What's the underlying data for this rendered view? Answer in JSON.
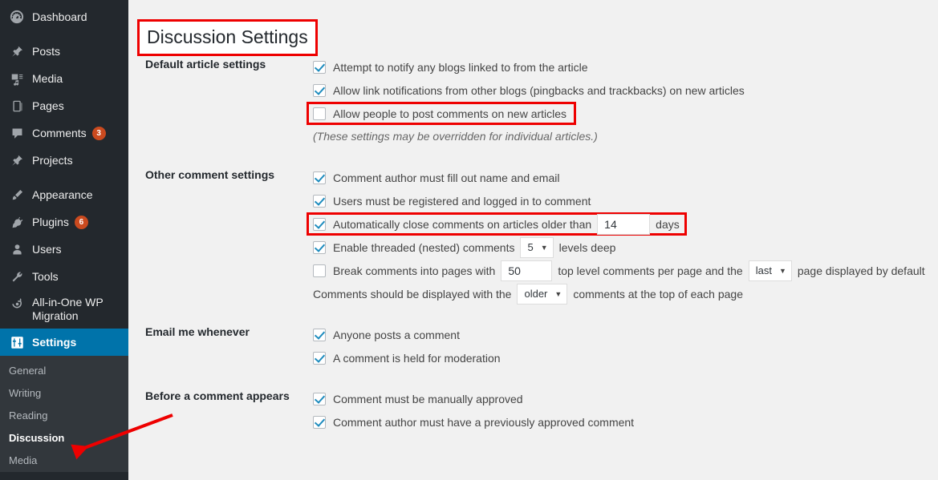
{
  "sidebar": {
    "items": [
      {
        "label": "Dashboard",
        "icon": "dashboard-icon",
        "badge": null,
        "current": false
      },
      {
        "label": "Posts",
        "icon": "pin-icon",
        "badge": null,
        "current": false
      },
      {
        "label": "Media",
        "icon": "media-icon",
        "badge": null,
        "current": false
      },
      {
        "label": "Pages",
        "icon": "pages-icon",
        "badge": null,
        "current": false
      },
      {
        "label": "Comments",
        "icon": "comment-bubble-icon",
        "badge": "3",
        "current": false
      },
      {
        "label": "Projects",
        "icon": "pin-icon",
        "badge": null,
        "current": false
      },
      {
        "label": "Appearance",
        "icon": "paintbrush-icon",
        "badge": null,
        "current": false
      },
      {
        "label": "Plugins",
        "icon": "plug-icon",
        "badge": "6",
        "current": false
      },
      {
        "label": "Users",
        "icon": "user-icon",
        "badge": null,
        "current": false
      },
      {
        "label": "Tools",
        "icon": "wrench-icon",
        "badge": null,
        "current": false
      },
      {
        "label": "All-in-One WP Migration",
        "icon": "migration-icon",
        "badge": null,
        "current": false
      },
      {
        "label": "Settings",
        "icon": "settings-sliders-icon",
        "badge": null,
        "current": true
      }
    ],
    "submenu": [
      {
        "label": "General",
        "current": false
      },
      {
        "label": "Writing",
        "current": false
      },
      {
        "label": "Reading",
        "current": false
      },
      {
        "label": "Discussion",
        "current": true
      },
      {
        "label": "Media",
        "current": false
      }
    ]
  },
  "page": {
    "title": "Discussion Settings"
  },
  "sections": {
    "default_article": {
      "heading": "Default article settings",
      "options": [
        {
          "label": "Attempt to notify any blogs linked to from the article",
          "checked": true,
          "highlighted": false
        },
        {
          "label": "Allow link notifications from other blogs (pingbacks and trackbacks) on new articles",
          "checked": true,
          "highlighted": false
        },
        {
          "label": "Allow people to post comments on new articles",
          "checked": false,
          "highlighted": true
        }
      ],
      "description": "(These settings may be overridden for individual articles.)"
    },
    "other_comment": {
      "heading": "Other comment settings",
      "opt_name_email": {
        "label": "Comment author must fill out name and email",
        "checked": true
      },
      "opt_registered": {
        "label": "Users must be registered and logged in to comment",
        "checked": true
      },
      "opt_auto_close": {
        "label": "Automatically close comments on articles older than",
        "checked": true,
        "value": "14",
        "suffix": "days",
        "highlighted": true
      },
      "opt_threaded": {
        "label": "Enable threaded (nested) comments",
        "checked": true,
        "value": "5",
        "suffix": "levels deep"
      },
      "opt_paginate": {
        "label": "Break comments into pages with",
        "checked": false,
        "value": "50",
        "middle": "top level comments per page and the",
        "page_value": "last",
        "suffix": "page displayed by default"
      },
      "opt_order": {
        "prefix": "Comments should be displayed with the",
        "value": "older",
        "suffix": "comments at the top of each page"
      }
    },
    "email_me": {
      "heading": "Email me whenever",
      "options": [
        {
          "label": "Anyone posts a comment",
          "checked": true
        },
        {
          "label": "A comment is held for moderation",
          "checked": true
        }
      ]
    },
    "before_comment": {
      "heading": "Before a comment appears",
      "options": [
        {
          "label": "Comment must be manually approved",
          "checked": true
        },
        {
          "label": "Comment author must have a previously approved comment",
          "checked": true
        }
      ]
    }
  },
  "colors": {
    "sidebar_bg": "#23282d",
    "submenu_bg": "#32373c",
    "accent_blue": "#0073aa",
    "badge_orange": "#ca4a1f",
    "annotation_red": "#ee0000",
    "checkmark_blue": "#1e8cbe"
  }
}
